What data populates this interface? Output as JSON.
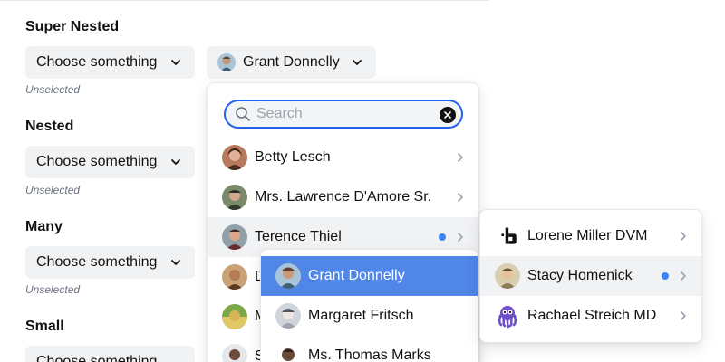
{
  "sections": [
    {
      "title": "Super Nested",
      "button_label": "Choose something",
      "status": "Unselected"
    },
    {
      "title": "Nested",
      "button_label": "Choose something",
      "status": "Unselected"
    },
    {
      "title": "Many",
      "button_label": "Choose something",
      "status": "Unselected"
    },
    {
      "title": "Small",
      "button_label": "Choose something"
    }
  ],
  "selected_value": {
    "label": "Grant Donnelly",
    "icon": "avatar-grant"
  },
  "search": {
    "placeholder": "Search",
    "value": ""
  },
  "menu1": {
    "items": [
      {
        "label": "Betty Lesch",
        "has_submenu": true
      },
      {
        "label": "Mrs. Lawrence D'Amore Sr.",
        "has_submenu": true
      },
      {
        "label": "Terence Thiel",
        "has_submenu": true,
        "highlighted": true,
        "selected_dot": true
      },
      {
        "label": "D",
        "has_submenu": true
      },
      {
        "label": "M",
        "has_submenu": true
      },
      {
        "label": "S",
        "has_submenu": true
      }
    ]
  },
  "menu2": {
    "items": [
      {
        "label": "Grant Donnelly",
        "active": true
      },
      {
        "label": "Margaret Fritsch"
      },
      {
        "label": "Ms. Thomas Marks"
      }
    ]
  },
  "menu3": {
    "items": [
      {
        "label": "Lorene Miller DVM",
        "icon": "bitbucket-like-logo-icon",
        "has_submenu": true
      },
      {
        "label": "Stacy Homenick",
        "has_submenu": true,
        "highlighted": true,
        "selected_dot": true
      },
      {
        "label": "Rachael Streich MD",
        "icon": "octopus-icon",
        "has_submenu": true
      }
    ]
  },
  "colors": {
    "accent": "#4f86e8",
    "focus_ring": "#2563eb",
    "dot": "#3b82f6",
    "button_bg": "#f1f2f4"
  }
}
